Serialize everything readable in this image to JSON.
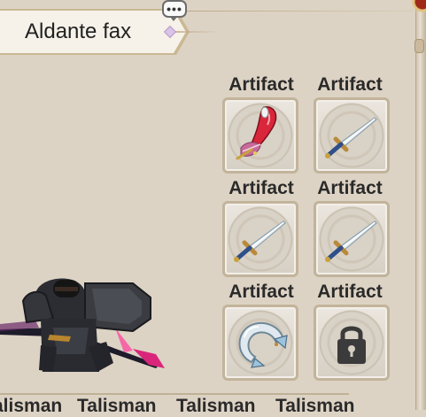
{
  "header": {
    "player_name": "Aldante fax",
    "chat_icon": "speech-bubble-icon",
    "chat_dots": "•••"
  },
  "slots": [
    {
      "label": "Artifact",
      "item": "red-feather-quill-icon",
      "locked": false
    },
    {
      "label": "Artifact",
      "item": "sword-icon",
      "locked": false
    },
    {
      "label": "Artifact",
      "item": "sword-icon",
      "locked": false
    },
    {
      "label": "Artifact",
      "item": "sword-icon",
      "locked": false
    },
    {
      "label": "Artifact",
      "item": "silver-ring-icon",
      "locked": false
    },
    {
      "label": "Artifact",
      "item": "lock-icon",
      "locked": true
    }
  ],
  "tabs": [
    {
      "label": "alisman"
    },
    {
      "label": "Talisman"
    },
    {
      "label": "Talisman"
    },
    {
      "label": "Talisman"
    }
  ],
  "character": {
    "model": "dark-armored-hero-figure"
  },
  "colors": {
    "background": "#ddd3c4",
    "slot_border": "#c2b49b",
    "accent_red": "#a02a1a"
  }
}
